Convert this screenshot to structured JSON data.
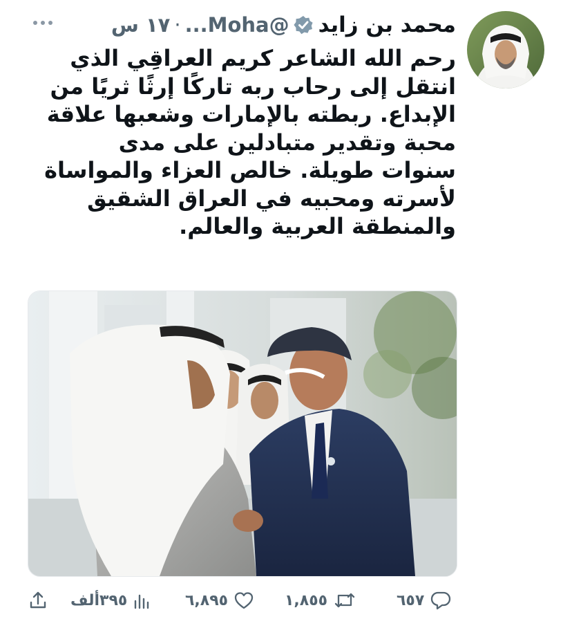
{
  "author": {
    "name": "محمد بن زايد",
    "handle": "@Moha...",
    "separator": "·",
    "time": "١٧ س",
    "avatar": "avatar-photo",
    "verified_color": "#829aab"
  },
  "menu_icon": "more-dots-icon",
  "tweet": {
    "text": "رحم الله الشاعر كريم العراقِي الذي انتقل إلى رحاب ربه تاركًا إرثًا ثريًا من الإبداع. ربطته بالإمارات وشعبها علاقة محبة وتقدير متبادلين على مدى سنوات طويلة. خالص العزاء والمواساة لأسرته ومحبيه في العراق الشقيق والمنطقة العربية والعالم."
  },
  "media": {
    "type": "photo"
  },
  "actions": {
    "replies": "٦٥٧",
    "retweets": "١,٨٥٥",
    "likes": "٦,٨٩٥",
    "views": "٣٩٥ألف"
  },
  "colors": {
    "text": "#0f1419",
    "secondary": "#536471",
    "border": "#e6e9ec"
  }
}
